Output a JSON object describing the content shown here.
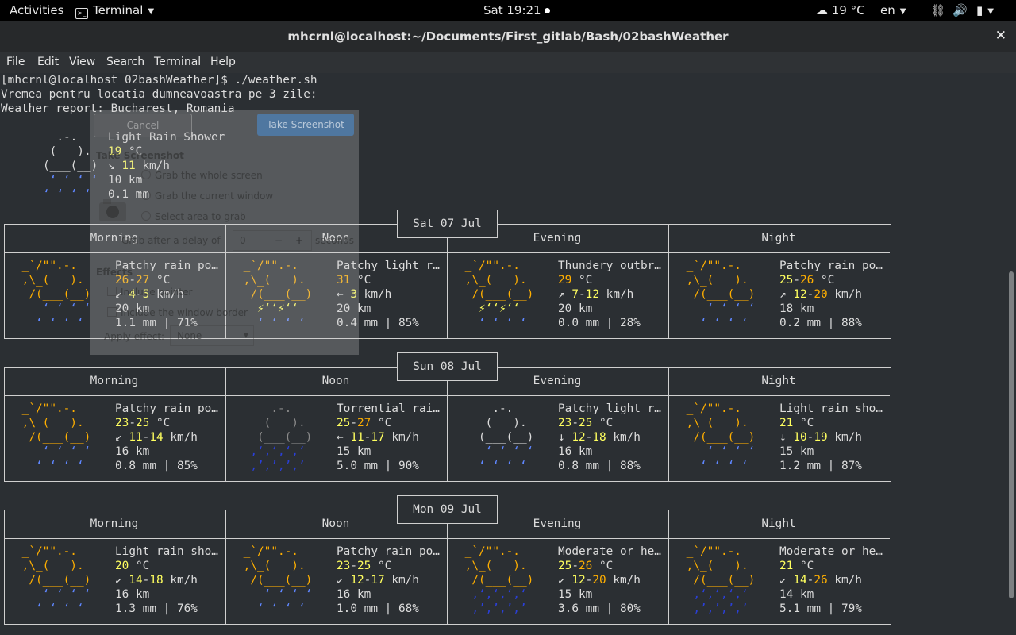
{
  "topbar": {
    "activities": "Activities",
    "app": "Terminal",
    "clock": "Sat 19:21",
    "weather": "19 °C",
    "lang": "en"
  },
  "window": {
    "title": "mhcrnl@localhost:~/Documents/First_gitlab/Bash/02bashWeather",
    "close": "✕"
  },
  "menu": [
    "File",
    "Edit",
    "View",
    "Search",
    "Terminal",
    "Help"
  ],
  "terminal": {
    "prompt_line": "[mhcrnl@localhost 02bashWeather]$ ./weather.sh",
    "line2": "Vremea pentru locatia dumneavoastra pe 3 zile:",
    "line3": "Weather report: Bucharest, Romania",
    "current": {
      "art": [
        "     .-.     ",
        "    (   ).   ",
        "   (___(__)  ",
        "    ‘ ‘ ‘ ‘  ",
        "   ‘ ‘ ‘ ‘   "
      ],
      "condition": "Light Rain Shower",
      "temp": "19",
      "temp_unit": " °C",
      "wind_arrow": "↘ ",
      "wind": "11",
      "wind_unit": " km/h",
      "visibility": "10 km",
      "precip": "0.1 mm"
    }
  },
  "day_headers": [
    "Morning",
    "Noon",
    "Evening",
    "Night"
  ],
  "days": [
    {
      "date": "Sat 07 Jul",
      "periods": [
        {
          "art": "partly_rain",
          "cond": "Patchy rain po…",
          "t1": "26",
          "t2": "27",
          "arrow": "↙ ",
          "w1": "4",
          "w2": "5",
          "vis": "20 km",
          "pre": "1.1 mm | 71%"
        },
        {
          "art": "thunder",
          "cond": "Patchy light r…",
          "t1": "31",
          "t2": "",
          "arrow": "← ",
          "w1": "3",
          "w2": "",
          "vis": "20 km",
          "pre": "0.4 mm | 85%"
        },
        {
          "art": "thunder",
          "cond": "Thundery outbr…",
          "t1": "29",
          "t2": "",
          "arrow": "↗ ",
          "w1": "7",
          "w2": "12",
          "vis": "20 km",
          "pre": "0.0 mm | 28%"
        },
        {
          "art": "partly_rain",
          "cond": "Patchy rain po…",
          "t1": "25",
          "t2": "26",
          "arrow": "↗ ",
          "w1": "12",
          "w2": "20",
          "vis": "18 km",
          "pre": "0.2 mm | 88%"
        }
      ]
    },
    {
      "date": "Sun 08 Jul",
      "periods": [
        {
          "art": "partly_rain",
          "cond": "Patchy rain po…",
          "t1": "23",
          "t2": "25",
          "arrow": "↙ ",
          "w1": "11",
          "w2": "14",
          "vis": "16 km",
          "pre": "0.8 mm | 85%"
        },
        {
          "art": "heavy_rain",
          "cond": "Torrential rai…",
          "t1": "25",
          "t2": "27",
          "arrow": "← ",
          "w1": "11",
          "w2": "17",
          "vis": "15 km",
          "pre": "5.0 mm | 90%"
        },
        {
          "art": "light_rain",
          "cond": "Patchy light r…",
          "t1": "23",
          "t2": "25",
          "arrow": "↓ ",
          "w1": "12",
          "w2": "18",
          "vis": "16 km",
          "pre": "0.8 mm | 88%"
        },
        {
          "art": "partly_rain",
          "cond": "Light rain sho…",
          "t1": "21",
          "t2": "",
          "arrow": "↓ ",
          "w1": "10",
          "w2": "19",
          "vis": "15 km",
          "pre": "1.2 mm | 87%"
        }
      ]
    },
    {
      "date": "Mon 09 Jul",
      "periods": [
        {
          "art": "partly_rain",
          "cond": "Light rain sho…",
          "t1": "20",
          "t2": "",
          "arrow": "↙ ",
          "w1": "14",
          "w2": "18",
          "vis": "16 km",
          "pre": "1.3 mm | 76%"
        },
        {
          "art": "partly_rain",
          "cond": "Patchy rain po…",
          "t1": "23",
          "t2": "25",
          "arrow": "↙ ",
          "w1": "12",
          "w2": "17",
          "vis": "16 km",
          "pre": "1.0 mm | 68%"
        },
        {
          "art": "partly_heavy",
          "cond": "Moderate or he…",
          "t1": "25",
          "t2": "26",
          "arrow": "↙ ",
          "w1": "12",
          "w2": "20",
          "vis": "15 km",
          "pre": "3.6 mm | 80%"
        },
        {
          "art": "partly_heavy",
          "cond": "Moderate or he…",
          "t1": "21",
          "t2": "",
          "arrow": "↙ ",
          "w1": "14",
          "w2": "26",
          "vis": "14 km",
          "pre": "5.1 mm | 79%"
        }
      ]
    }
  ],
  "dialog": {
    "cancel": "Cancel",
    "take": "Take Screenshot",
    "heading": "Take Screenshot",
    "opt1": "Grab the whole screen",
    "opt2": "Grab the current window",
    "opt3": "Select area to grab",
    "delay_label": "Grab after a delay of",
    "delay_value": "0",
    "delay_unit": "seconds",
    "effects": "Effects",
    "include_pointer": "Include pointer",
    "include_border": "Include the window border",
    "apply_effect": "Apply effect:",
    "effect_value": "None"
  },
  "colors": {
    "terminal_bg": "#2b2f33",
    "yellow": "#ffff5f",
    "orange": "#ffaf00",
    "rain_blue": "#5f87ff",
    "heavy_rain_blue": "#2a3fd8"
  }
}
